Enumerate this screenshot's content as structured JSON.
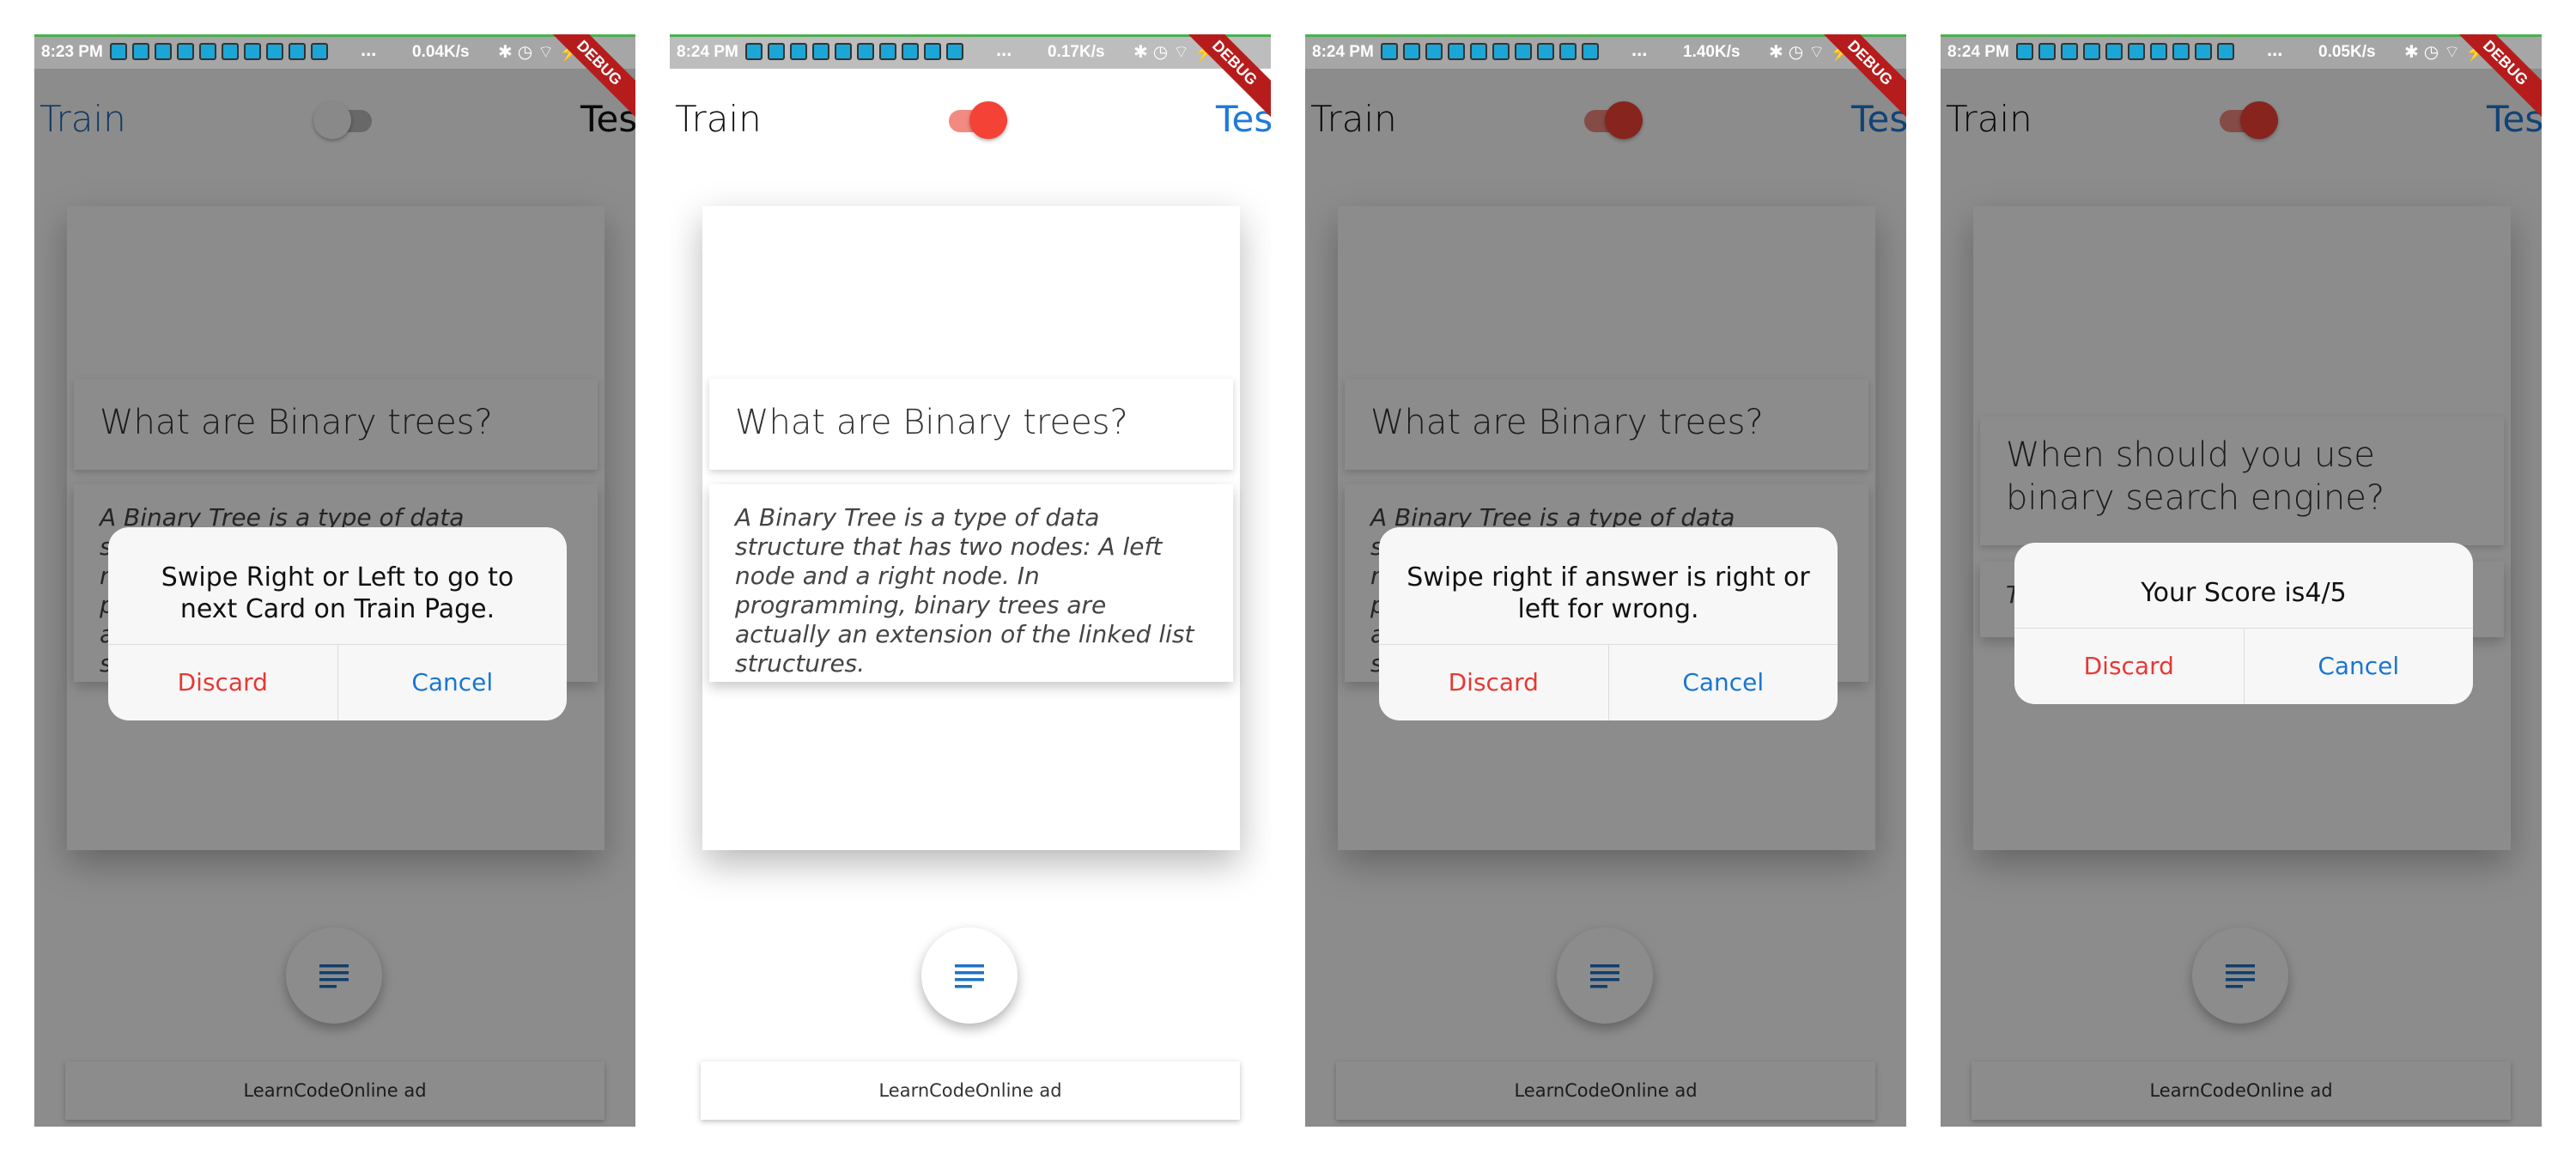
{
  "status": [
    {
      "time": "8:23 PM",
      "speed": "0.04K/s"
    },
    {
      "time": "8:24 PM",
      "speed": "0.17K/s"
    },
    {
      "time": "8:24 PM",
      "speed": "1.40K/s"
    },
    {
      "time": "8:24 PM",
      "speed": "0.05K/s"
    }
  ],
  "status_more": "...",
  "status_right_glyphs": "✱◷⌔⚡",
  "debug_label": "DEBUG",
  "appbar": {
    "left_title": "Train",
    "right_title": "Test"
  },
  "toggle_states": [
    "off",
    "on",
    "on",
    "on"
  ],
  "card": {
    "question": "What are Binary trees?",
    "answer": "A Binary Tree is a type of data structure that has two nodes: A left node and a right node. In programming, binary trees are actually an extension of the linked list structures.",
    "question_alt": "When should you use binary search engine?",
    "answer_alt": "To"
  },
  "ad_text": "LearnCodeOnline ad",
  "dialogs": [
    {
      "message": "Swipe Right or Left to go to next Card on Train Page.",
      "discard": "Discard",
      "cancel": "Cancel"
    },
    {
      "message": "Swipe right if answer is right or left for wrong.",
      "discard": "Discard",
      "cancel": "Cancel"
    },
    {
      "message": "Your Score is4/5",
      "discard": "Discard",
      "cancel": "Cancel"
    }
  ],
  "colors": {
    "accent": "#f44336",
    "link": "#1f7bd8",
    "discard": "#e53935",
    "cancel": "#1976d2"
  },
  "icons": [
    "menu-lines-icon",
    "bluetooth-icon",
    "alarm-icon",
    "wifi-icon",
    "battery-icon"
  ]
}
